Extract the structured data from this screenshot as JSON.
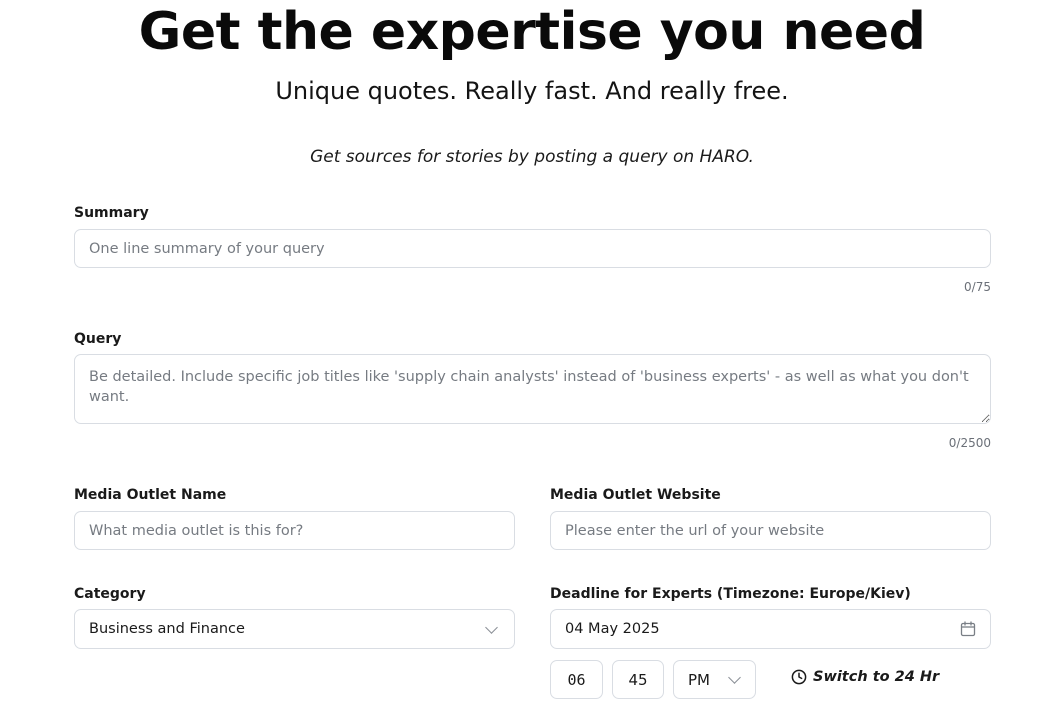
{
  "hero": {
    "title": "Get the expertise you need",
    "subtitle": "Unique quotes. Really fast. And really free.",
    "tagline": "Get sources for stories by posting a query on HARO."
  },
  "form": {
    "summary": {
      "label": "Summary",
      "placeholder": "One line summary of your query",
      "value": "",
      "counter": "0/75"
    },
    "query": {
      "label": "Query",
      "placeholder": "Be detailed. Include specific job titles like 'supply chain analysts' instead of 'business experts' - as well as what you don't want.",
      "value": "",
      "counter": "0/2500"
    },
    "media_outlet_name": {
      "label": "Media Outlet Name",
      "placeholder": "What media outlet is this for?"
    },
    "media_outlet_website": {
      "label": "Media Outlet Website",
      "placeholder": "Please enter the url of your website"
    },
    "category": {
      "label": "Category",
      "selected": "Business and Finance"
    },
    "deadline": {
      "label": "Deadline for Experts (Timezone: Europe/Kiev)",
      "date": "04 May 2025",
      "hour": "06",
      "minute": "45",
      "period": "PM",
      "switch_label": "Switch to 24 Hr"
    }
  },
  "icons": {
    "calendar": "calendar-icon",
    "clock": "clock-icon",
    "chevron": "chevron-down-icon"
  }
}
